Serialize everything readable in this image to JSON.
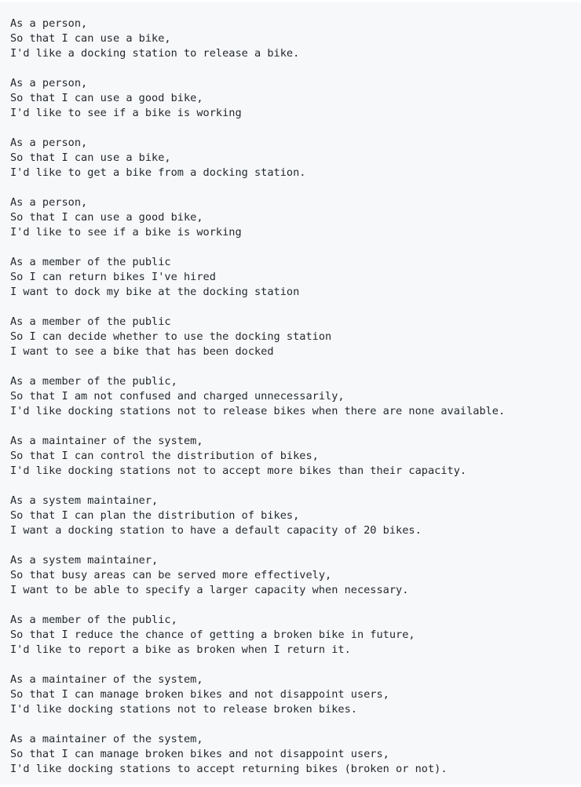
{
  "stories": [
    [
      "As a person,",
      "So that I can use a bike,",
      "I'd like a docking station to release a bike."
    ],
    [
      "As a person,",
      "So that I can use a good bike,",
      "I'd like to see if a bike is working"
    ],
    [
      "As a person,",
      "So that I can use a bike,",
      "I'd like to get a bike from a docking station."
    ],
    [
      "As a person,",
      "So that I can use a good bike,",
      "I'd like to see if a bike is working"
    ],
    [
      "As a member of the public",
      "So I can return bikes I've hired",
      "I want to dock my bike at the docking station"
    ],
    [
      "As a member of the public",
      "So I can decide whether to use the docking station",
      "I want to see a bike that has been docked"
    ],
    [
      "As a member of the public,",
      "So that I am not confused and charged unnecessarily,",
      "I'd like docking stations not to release bikes when there are none available."
    ],
    [
      "As a maintainer of the system,",
      "So that I can control the distribution of bikes,",
      "I'd like docking stations not to accept more bikes than their capacity."
    ],
    [
      "As a system maintainer,",
      "So that I can plan the distribution of bikes,",
      "I want a docking station to have a default capacity of 20 bikes."
    ],
    [
      "As a system maintainer,",
      "So that busy areas can be served more effectively,",
      "I want to be able to specify a larger capacity when necessary."
    ],
    [
      "As a member of the public,",
      "So that I reduce the chance of getting a broken bike in future,",
      "I'd like to report a bike as broken when I return it."
    ],
    [
      "As a maintainer of the system,",
      "So that I can manage broken bikes and not disappoint users,",
      "I'd like docking stations not to release broken bikes."
    ],
    [
      "As a maintainer of the system,",
      "So that I can manage broken bikes and not disappoint users,",
      "I'd like docking stations to accept returning bikes (broken or not)."
    ]
  ]
}
